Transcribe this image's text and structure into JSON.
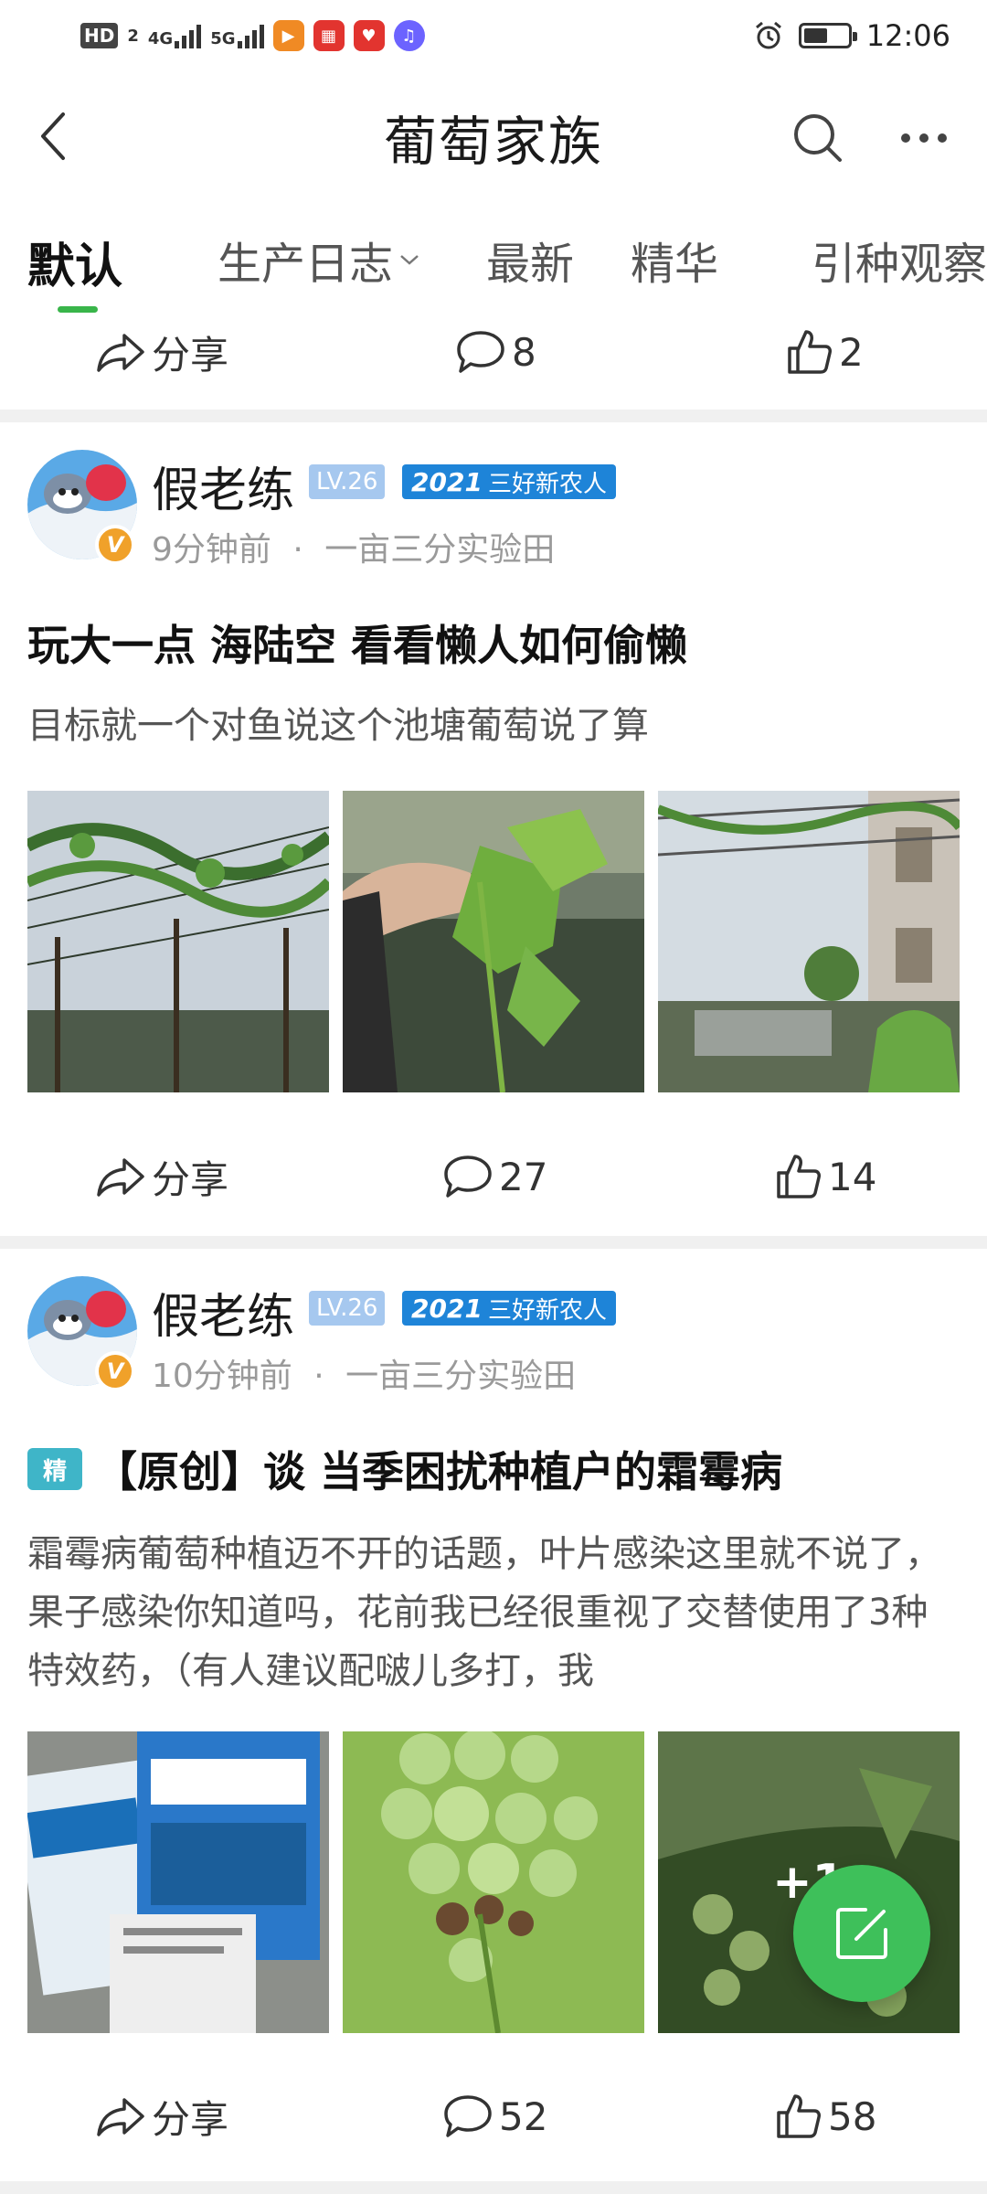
{
  "status_bar": {
    "hd_label": "HD",
    "sim_label": "2",
    "net1": "4G",
    "net2": "5G",
    "battery_percent": 55,
    "time": "12:06",
    "app_icons": [
      "play-app-icon",
      "book-app-icon",
      "heart-app-icon",
      "music-app-icon"
    ]
  },
  "header": {
    "title": "葡萄家族",
    "back_icon": "chevron-left-icon",
    "search_icon": "search-icon",
    "more_icon": "more-dots-icon"
  },
  "tabs": [
    {
      "label": "默认",
      "active": true
    },
    {
      "label": "生产日志",
      "has_dropdown": true
    },
    {
      "label": "最新"
    },
    {
      "label": "精华"
    },
    {
      "label": "引种观察"
    }
  ],
  "top_actions": {
    "share": "分享",
    "comments": "8",
    "likes": "2"
  },
  "posts": [
    {
      "author": "假老练",
      "level": "LV.26",
      "honor_year": "2021",
      "honor_text": "三好新农人",
      "time": "9分钟前",
      "separator": "·",
      "location": "一亩三分实验田",
      "title": "玩大一点 海陆空 看看懒人如何偷懒",
      "excerpt": "目标就一个对鱼说这个池塘葡萄说了算",
      "share": "分享",
      "comments": "27",
      "likes": "14"
    },
    {
      "author": "假老练",
      "level": "LV.26",
      "honor_year": "2021",
      "honor_text": "三好新农人",
      "time": "10分钟前",
      "separator": "·",
      "location": "一亩三分实验田",
      "essence_tag": "精",
      "title": "【原创】谈 当季困扰种植户的霜霉病",
      "excerpt": "霜霉病葡萄种植迈不开的话题，叶片感染这里就不说了，果子感染你知道吗，花前我已经很重视了交替使用了3种特效药，（有人建议配啵儿多打，我",
      "more_photos": "+1",
      "share": "分享",
      "comments": "52",
      "likes": "58"
    }
  ],
  "colors": {
    "accent_green": "#39b54a",
    "fab_green": "#3ec05a",
    "honor_blue": "#1e84d8",
    "level_blue": "#a6c8ef"
  },
  "fab_icon": "compose-icon"
}
